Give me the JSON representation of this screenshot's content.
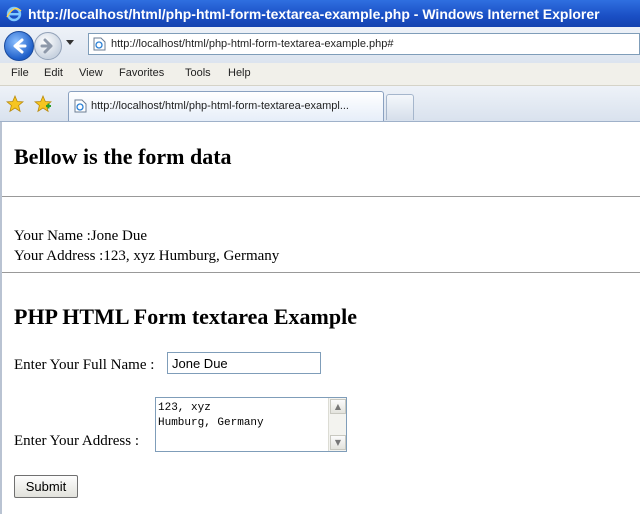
{
  "window": {
    "title": "http://localhost/html/php-html-form-textarea-example.php - Windows Internet Explorer"
  },
  "address_bar": {
    "url": "http://localhost/html/php-html-form-textarea-example.php#"
  },
  "menu": {
    "items": [
      "File",
      "Edit",
      "View",
      "Favorites",
      "Tools",
      "Help"
    ]
  },
  "tab": {
    "label": "http://localhost/html/php-html-form-textarea-exampl..."
  },
  "page": {
    "result_heading": "Bellow is the form data",
    "name_line": "Your Name :Jone Due",
    "address_line": "Your Address :123, xyz Humburg, Germany",
    "form_heading": "PHP HTML Form textarea Example",
    "name_label": "Enter Your Full Name :",
    "name_value": "Jone Due",
    "address_label": "Enter Your Address :",
    "address_value": "123, xyz\nHumburg, Germany",
    "submit_label": "Submit"
  },
  "icons": {
    "title_icon": "ie-logo-icon",
    "back": "back-arrow-icon",
    "forward": "forward-arrow-icon",
    "page": "page-icon",
    "favorites": "favorites-star-icon",
    "add_favorites": "add-favorites-icon"
  },
  "colors": {
    "titlebar": "#1a4fc4",
    "chrome": "#dce4ef",
    "content_bg": "#ffffff"
  }
}
